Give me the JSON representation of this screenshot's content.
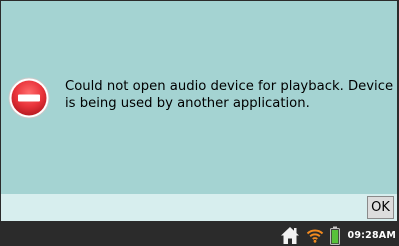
{
  "dialog": {
    "message": "Could not open audio device for playback. Device is being used by another application.",
    "icon": "error-icon",
    "ok_label": "OK"
  },
  "taskbar": {
    "icons": [
      "home-icon",
      "wifi-icon",
      "battery-icon"
    ],
    "clock": "09:28AM"
  },
  "colors": {
    "dialog_background": "#a4d3d2",
    "button_bar": "#d7eeee",
    "taskbar": "#2b2b2b",
    "error_red": "#e8333a",
    "battery_green": "#57c23a"
  }
}
